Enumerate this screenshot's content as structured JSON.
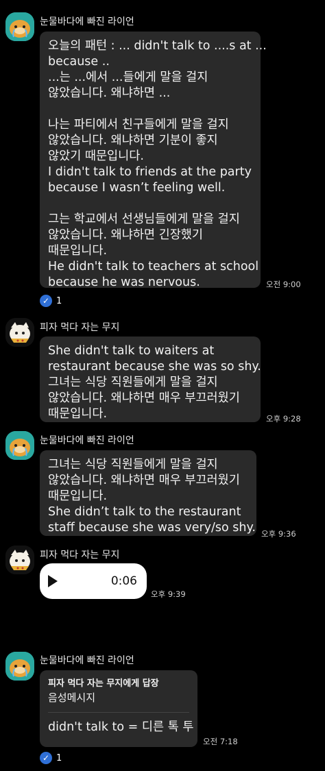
{
  "messages": [
    {
      "sender": "눈물바다에 빠진 라이언",
      "lines": [
        "오늘의 패턴 : ... didn't talk to ....s at ...",
        "because ..",
        "...는 ...에서 ...들에게 말을 걸지",
        "않았습니다. 왜냐하면 ...",
        "",
        "나는 파티에서 친구들에게 말을 걸지",
        "않았습니다. 왜냐하면 기분이 좋지",
        "않았기 때문입니다.",
        "I didn't talk to friends at the party",
        "because I wasn’t feeling well.",
        "",
        "그는 학교에서 선생님들에게 말을 걸지",
        "않았습니다. 왜냐하면 긴장했기",
        "때문입니다.",
        "He didn't talk to teachers at school",
        "because he was nervous."
      ],
      "time": "오전 9:00",
      "reaction_count": "1"
    },
    {
      "sender": "피자 먹다 자는 무지",
      "lines": [
        "She didn't talk to waiters at",
        "restaurant because she was so shy.",
        "그녀는 식당 직원들에게 말을 걸지",
        "않았습니다. 왜냐하면 매우 부끄러웠기",
        "때문입니다."
      ],
      "time": "오후 9:28"
    },
    {
      "sender": "눈물바다에 빠진 라이언",
      "lines": [
        "그녀는 식당 직원들에게 말을 걸지",
        "않았습니다. 왜냐하면 매우 부끄러웠기",
        "때문입니다.",
        "She didn’t talk to the restaurant",
        "staff because she was very/so shy."
      ],
      "time": "오후 9:36"
    },
    {
      "sender": "피자 먹다 자는 무지",
      "voice_duration": "0:06",
      "time": "오후 9:39"
    },
    {
      "sender": "눈물바다에 빠진 라이언",
      "reply_title": "피자 먹다 자는 무지에게 답장",
      "reply_sub": "음성메시지",
      "text": "didn't talk to = 디른 톡 투",
      "time": "오전 7:18",
      "reaction_count": "1"
    }
  ],
  "colors": {
    "background": "#000000",
    "bubble": "#2a2a2a",
    "reaction_check": "#2f6fd6",
    "voice_bubble": "#ffffff"
  },
  "icons": [
    "lion-avatar-icon",
    "muzi-avatar-icon",
    "check-icon",
    "play-icon"
  ]
}
